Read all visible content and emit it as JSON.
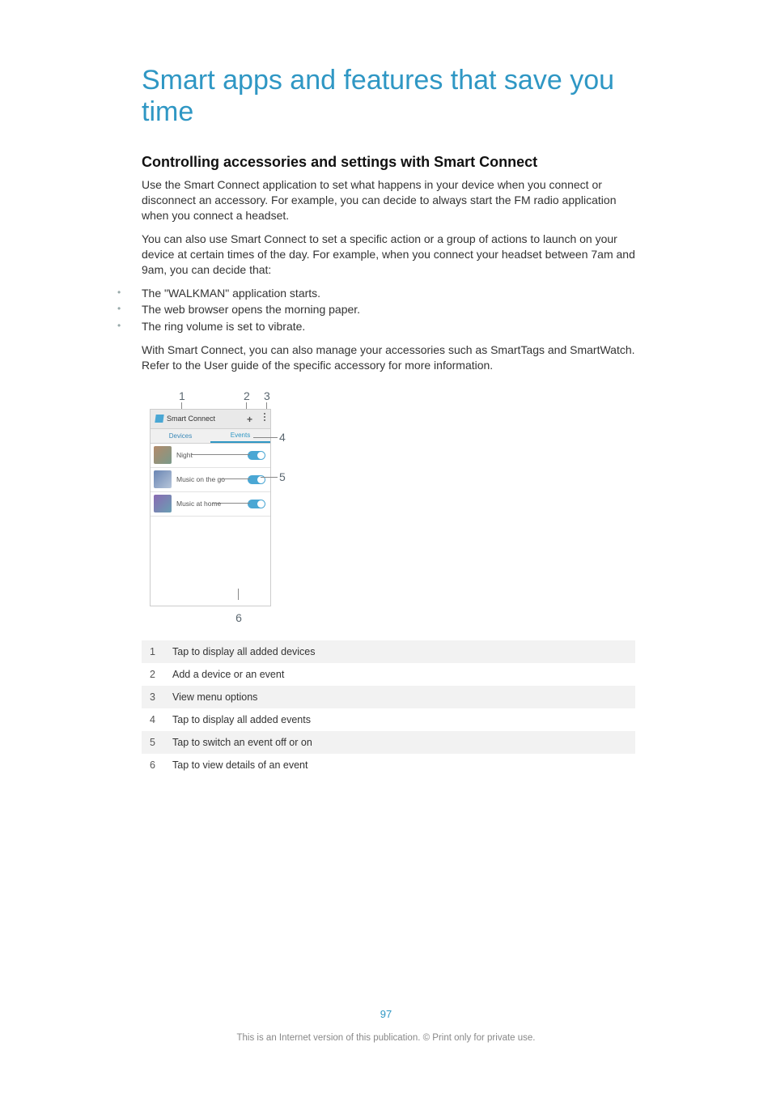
{
  "title": "Smart apps and features that save you time",
  "subheading": "Controlling accessories and settings with Smart Connect",
  "para1": "Use the Smart Connect application to set what happens in your device when you connect or disconnect an accessory. For example, you can decide to always start the FM radio application when you connect a headset.",
  "para2": "You can also use Smart Connect to set a specific action or a group of actions to launch on your device at certain times of the day. For example, when you connect your headset between 7am and 9am, you can decide that:",
  "bullets": [
    "The \"WALKMAN\" application starts.",
    "The web browser opens the morning paper.",
    "The ring volume is set to vibrate."
  ],
  "para3": "With Smart Connect, you can also manage your accessories such as SmartTags and SmartWatch. Refer to the User guide of the specific accessory for more information.",
  "callouts": {
    "c1": "1",
    "c2": "2",
    "c3": "3",
    "c4": "4",
    "c5": "5",
    "c6": "6"
  },
  "phone": {
    "app_title": "Smart Connect",
    "tab_devices": "Devices",
    "tab_events": "Events",
    "rows": [
      "Night",
      "Music on the go",
      "Music at home"
    ]
  },
  "legend": [
    {
      "n": "1",
      "t": "Tap to display all added devices"
    },
    {
      "n": "2",
      "t": "Add a device or an event"
    },
    {
      "n": "3",
      "t": "View menu options"
    },
    {
      "n": "4",
      "t": "Tap to display all added events"
    },
    {
      "n": "5",
      "t": "Tap to switch an event off or on"
    },
    {
      "n": "6",
      "t": "Tap to view details of an event"
    }
  ],
  "page_number": "97",
  "footer_note": "This is an Internet version of this publication. © Print only for private use."
}
